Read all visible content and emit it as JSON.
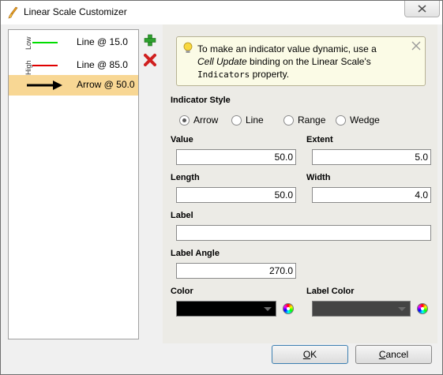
{
  "window": {
    "title": "Linear Scale Customizer"
  },
  "indicators": [
    {
      "range_tag": "Low",
      "label": "Line @ 15.0",
      "kind": "line",
      "color": "#00dd00",
      "selected": false
    },
    {
      "range_tag": "High",
      "label": "Line @ 85.0",
      "kind": "line",
      "color": "#e00000",
      "selected": false
    },
    {
      "range_tag": "",
      "label": "Arrow @ 50.0",
      "kind": "arrow",
      "color": "#000000",
      "selected": true
    }
  ],
  "tip": {
    "line1": "To make an indicator value dynamic, use a",
    "italic": "Cell Update",
    "line2_rest": " binding on the Linear Scale's",
    "mono": "Indicators",
    "line3_rest": " property."
  },
  "form": {
    "indicator_style_label": "Indicator Style",
    "styles": [
      {
        "label": "Arrow",
        "selected": true
      },
      {
        "label": "Line",
        "selected": false
      },
      {
        "label": "Range",
        "selected": false
      },
      {
        "label": "Wedge",
        "selected": false
      }
    ],
    "value_label": "Value",
    "value": "50.0",
    "extent_label": "Extent",
    "extent": "5.0",
    "length_label": "Length",
    "length": "50.0",
    "width_label": "Width",
    "width": "4.0",
    "label_label": "Label",
    "label": "",
    "label_angle_label": "Label Angle",
    "label_angle": "270.0",
    "color_label": "Color",
    "color": "#000000",
    "label_color_label": "Label Color",
    "label_color": "#444444"
  },
  "buttons": {
    "ok": "OK",
    "ok_mnemonic": "O",
    "ok_rest": "K",
    "cancel": "Cancel",
    "cancel_mnemonic": "C",
    "cancel_rest": "ancel"
  }
}
